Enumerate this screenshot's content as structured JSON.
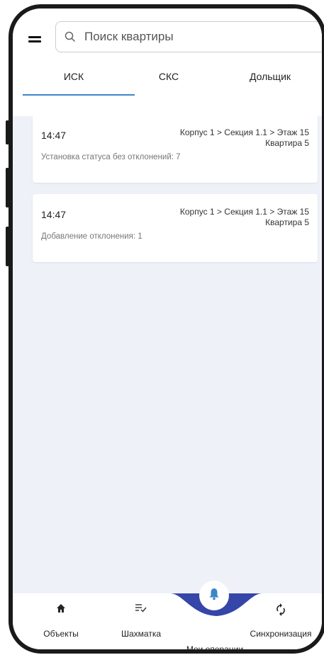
{
  "search": {
    "placeholder": "Поиск квартиры"
  },
  "tabs": [
    {
      "label": "ИСК",
      "active": true
    },
    {
      "label": "СКС",
      "active": false
    },
    {
      "label": "Дольщик",
      "active": false
    }
  ],
  "operations": [
    {
      "time": "14:47",
      "location_line1": "Корпус 1 > Секция 1.1 > Этаж 15",
      "location_line2": "Квартира 5",
      "description": "Установка статуса без отклонений: 7"
    },
    {
      "time": "14:47",
      "location_line1": "Корпус 1 > Секция 1.1 > Этаж 15",
      "location_line2": "Квартира 5",
      "description": "Добавление отклонения: 1"
    }
  ],
  "bottom_nav": [
    {
      "label": "Объекты",
      "icon": "home-icon"
    },
    {
      "label": "Шахматка",
      "icon": "list-check-icon"
    },
    {
      "label": "Мои операции",
      "icon": "bell-icon",
      "active": true
    },
    {
      "label": "Синхронизация",
      "icon": "sync-icon"
    }
  ],
  "colors": {
    "accent": "#3b86c8",
    "nav_active": "#3545a8",
    "background": "#eef1f8"
  }
}
